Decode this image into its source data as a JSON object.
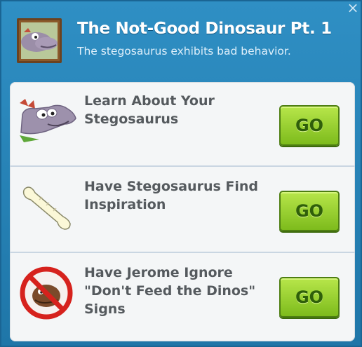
{
  "header": {
    "title": "The Not-Good Dinosaur Pt. 1",
    "subtitle": "The stegosaurus exhibits bad behavior.",
    "close_label": "×"
  },
  "tasks": [
    {
      "label": "Learn About Your Stegosaurus",
      "button": "GO",
      "icon": "stegosaurus-head-icon"
    },
    {
      "label": "Have Stegosaurus Find Inspiration",
      "button": "GO",
      "icon": "bone-icon"
    },
    {
      "label": "Have Jerome Ignore \"Don't Feed the Dinos\" Signs",
      "button": "GO",
      "icon": "no-dinosaur-icon"
    }
  ],
  "colors": {
    "header_blue": "#2f8fc4",
    "panel": "#f4f6f7",
    "go_button_green": "#9fd62f",
    "prohibition_red": "#d6221d"
  }
}
